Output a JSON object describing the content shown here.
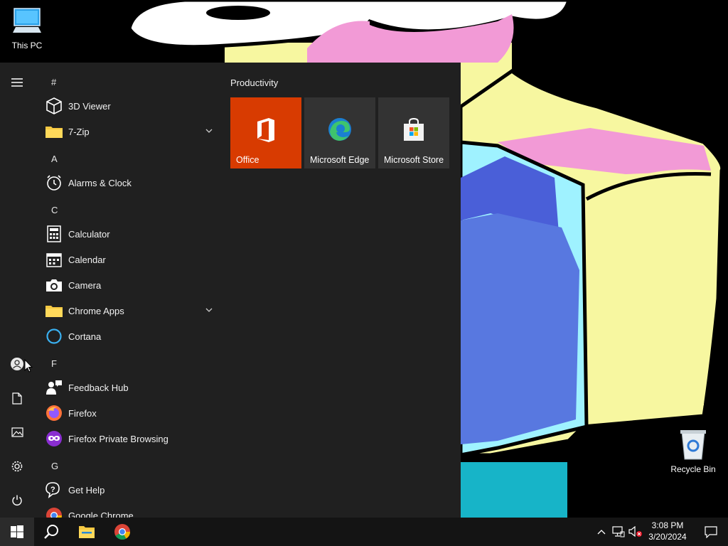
{
  "desktop": {
    "icons": [
      {
        "label": "This PC",
        "icon": "this-pc-icon"
      },
      {
        "label": "Recycle Bin",
        "icon": "recycle-bin-icon"
      }
    ]
  },
  "start_menu": {
    "rail": {
      "icons": [
        "hamburger-menu-icon",
        "user-account-icon",
        "documents-icon",
        "pictures-icon",
        "settings-icon",
        "power-icon"
      ]
    },
    "app_list": {
      "headers": [
        "#",
        "A",
        "C",
        "F",
        "G"
      ],
      "apps": [
        {
          "name": "3D Viewer",
          "icon": "3d-viewer-icon"
        },
        {
          "name": "7-Zip",
          "icon": "folder-icon",
          "expandable": true
        },
        {
          "name": "Alarms & Clock",
          "icon": "alarms-clock-icon"
        },
        {
          "name": "Calculator",
          "icon": "calculator-icon"
        },
        {
          "name": "Calendar",
          "icon": "calendar-icon"
        },
        {
          "name": "Camera",
          "icon": "camera-icon"
        },
        {
          "name": "Chrome Apps",
          "icon": "folder-icon",
          "expandable": true
        },
        {
          "name": "Cortana",
          "icon": "cortana-icon"
        },
        {
          "name": "Feedback Hub",
          "icon": "feedback-hub-icon"
        },
        {
          "name": "Firefox",
          "icon": "firefox-icon"
        },
        {
          "name": "Firefox Private Browsing",
          "icon": "firefox-private-icon"
        },
        {
          "name": "Get Help",
          "icon": "get-help-icon"
        },
        {
          "name": "Google Chrome",
          "icon": "chrome-icon"
        }
      ]
    },
    "tiles": {
      "group_title": "Productivity",
      "items": [
        {
          "label": "Office",
          "icon": "office-icon",
          "color": "#d83b01"
        },
        {
          "label": "Microsoft Edge",
          "icon": "edge-icon",
          "color": "#333333"
        },
        {
          "label": "Microsoft Store",
          "icon": "store-icon",
          "color": "#333333"
        }
      ]
    }
  },
  "taskbar": {
    "pinned": [
      "start-icon",
      "search-icon",
      "file-explorer-icon",
      "chrome-icon"
    ],
    "tray_icons": [
      "show-hidden-icons-chevron",
      "network-icon",
      "volume-muted-icon",
      "notifications-icon"
    ],
    "time": "3:08 PM",
    "date": "3/20/2024"
  },
  "colors": {
    "start_bg": "#202020",
    "taskbar_bg": "#141414",
    "office_tile": "#d83b01",
    "tile_bg": "#333333"
  }
}
